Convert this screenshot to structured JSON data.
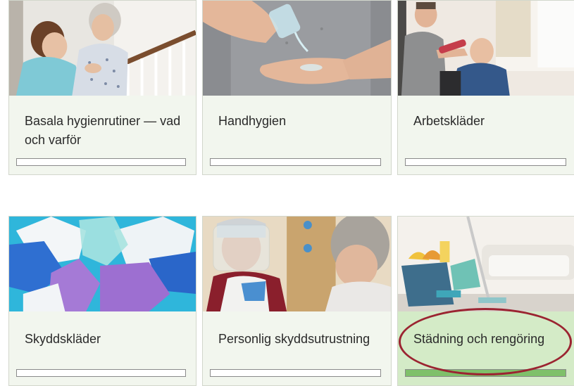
{
  "courses": [
    {
      "title": "Basala hygienrutiner — vad och varför",
      "progress": 0,
      "image": "caregiver-helping-elderly-woman-on-stairs"
    },
    {
      "title": "Handhygien",
      "progress": 0,
      "image": "hands-with-hand-sanitizer"
    },
    {
      "title": "Arbetskläder",
      "progress": 0,
      "image": "caregiver-with-patient-in-room"
    },
    {
      "title": "Skyddskläder",
      "progress": 0,
      "image": "colorful-disposable-gloves"
    },
    {
      "title": "Personlig skyddsutrustning",
      "progress": 0,
      "image": "worker-with-face-shield-and-apron"
    },
    {
      "title": "Städning och rengöring",
      "progress": 1,
      "image": "cleaning-supplies-bucket-and-mop"
    }
  ],
  "colors": {
    "card_bg": "#f2f6ee",
    "card_bg_completed": "#d4ebc7",
    "progress_fill": "#7fc06a",
    "annotation": "#9b2431"
  }
}
